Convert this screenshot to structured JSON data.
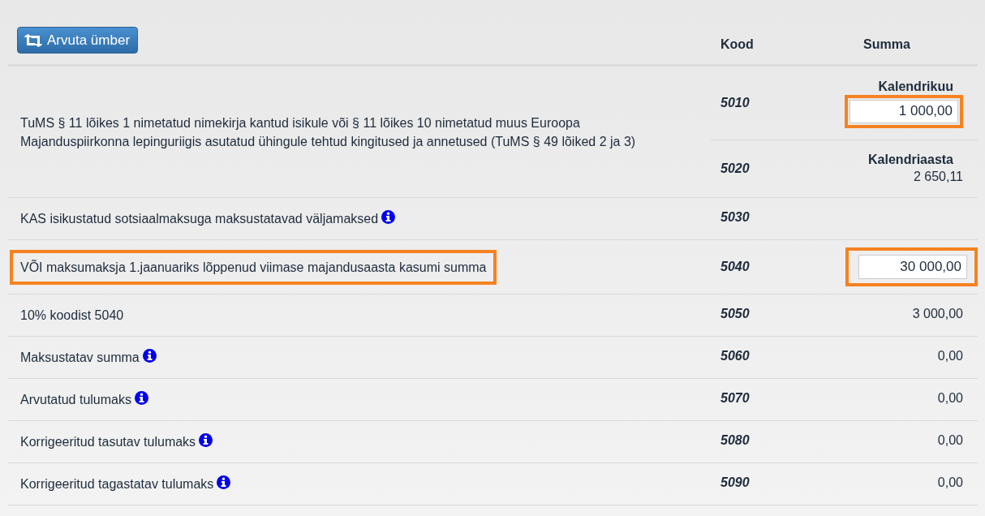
{
  "recalc_button": {
    "label": "Arvuta ümber"
  },
  "columns": [
    "Kood",
    "Summa"
  ],
  "rows": [
    {
      "label": "TuMS § 11 lõikes 1 nimetatud nimekirja kantud isikule või § 11 lõikes 10 nimetatud muus Euroopa Majanduspiirkonna lepinguriigis asutatud ühingule tehtud kingitused ja annetused (TuMS § 49 lõiked 2 ja 3)",
      "info": false,
      "highlighted": false,
      "lines": [
        {
          "code": "5010",
          "caption": "Kalendrikuu",
          "kind": "input",
          "value": "1 000,00",
          "highlighted": true
        },
        {
          "code": "5020",
          "caption": "Kalendriaasta",
          "kind": "text",
          "value": "2 650,11"
        }
      ]
    },
    {
      "label": "KAS isikustatud sotsiaalmaksuga maksustatavad väljamaksed",
      "info": true,
      "highlighted": false,
      "lines": [
        {
          "code": "5030",
          "kind": "empty"
        }
      ]
    },
    {
      "label": "VÕI maksumaksja 1.jaanuariks lõppenud viimase majandusaasta kasumi summa",
      "info": false,
      "highlighted": true,
      "lines": [
        {
          "code": "5040",
          "kind": "input",
          "value": "30 000,00",
          "highlighted": true
        }
      ]
    },
    {
      "label": "10% koodist 5040",
      "info": false,
      "highlighted": false,
      "lines": [
        {
          "code": "5050",
          "kind": "text",
          "value": "3 000,00"
        }
      ]
    },
    {
      "label": "Maksustatav summa",
      "info": true,
      "highlighted": false,
      "lines": [
        {
          "code": "5060",
          "kind": "text",
          "value": "0,00"
        }
      ]
    },
    {
      "label": "Arvutatud tulumaks",
      "info": true,
      "highlighted": false,
      "lines": [
        {
          "code": "5070",
          "kind": "text",
          "value": "0,00"
        }
      ]
    },
    {
      "label": "Korrigeeritud tasutav tulumaks",
      "info": true,
      "highlighted": false,
      "lines": [
        {
          "code": "5080",
          "kind": "text",
          "value": "0,00"
        }
      ]
    },
    {
      "label": "Korrigeeritud tagastatav tulumaks",
      "info": true,
      "highlighted": false,
      "lines": [
        {
          "code": "5090",
          "kind": "text",
          "value": "0,00"
        }
      ]
    }
  ]
}
